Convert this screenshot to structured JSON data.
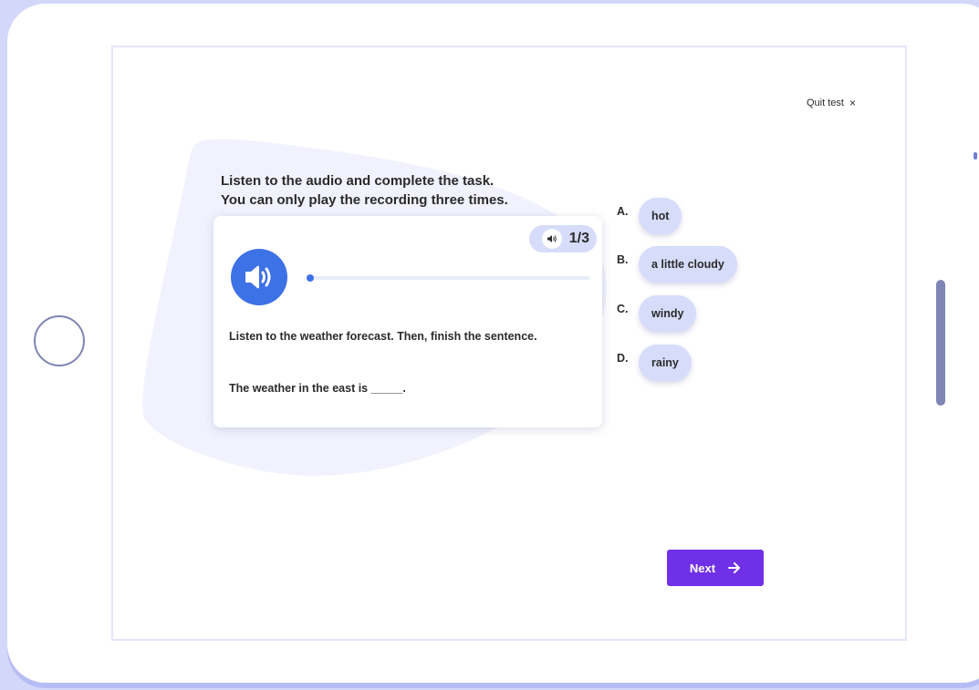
{
  "quit": {
    "label": "Quit test",
    "close_symbol": "×"
  },
  "instructions": {
    "line1": "Listen to the audio and complete the task.",
    "line2": "You can only play the recording three times."
  },
  "player": {
    "play_count": "1/3",
    "progress_fraction": 0.0
  },
  "question": {
    "prompt": "Listen to the weather forecast. Then, finish the sentence.",
    "sentence": "The weather in the east is _____."
  },
  "options": [
    {
      "letter": "A.",
      "text": "hot"
    },
    {
      "letter": "B.",
      "text": "a little cloudy"
    },
    {
      "letter": "C.",
      "text": "windy"
    },
    {
      "letter": "D.",
      "text": "rainy"
    }
  ],
  "next_button": {
    "label": "Next"
  },
  "colors": {
    "accent_blue": "#3d71e6",
    "pill_bg": "#d6dcfa",
    "next_purple": "#7030e8",
    "device_bg": "#d3d8fb"
  }
}
